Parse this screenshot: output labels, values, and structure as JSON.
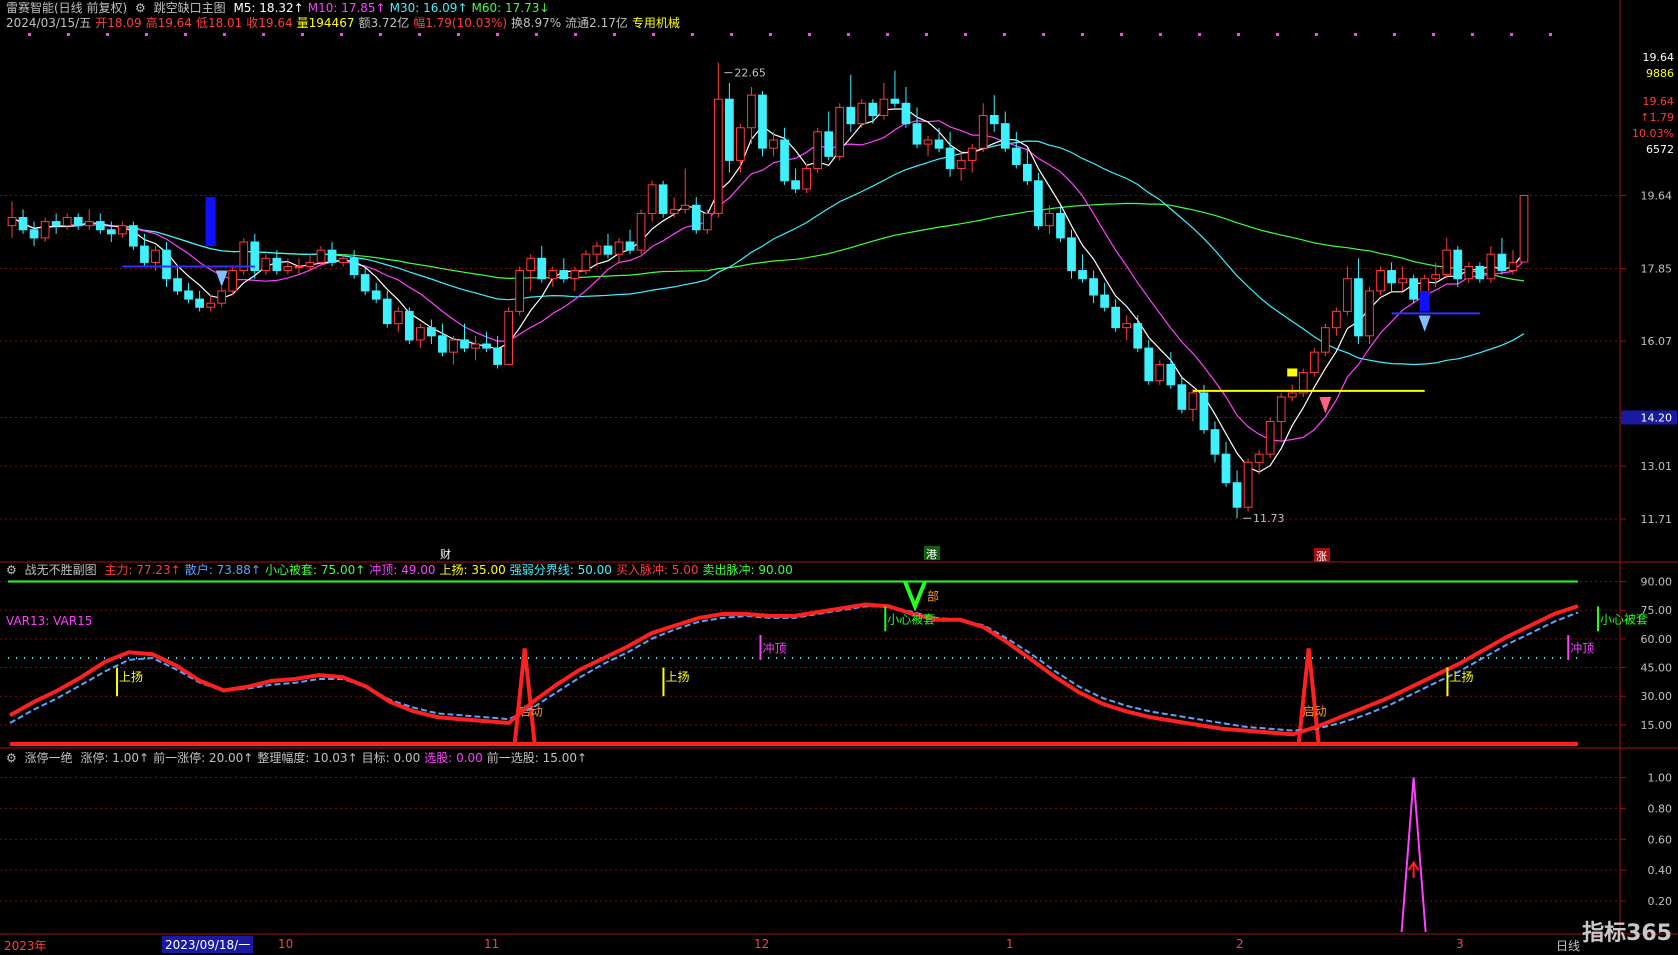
{
  "header": {
    "title": "雷赛智能(日线 前复权)",
    "indicator": "跳空缺口主图",
    "ma": [
      {
        "label": "M5:",
        "value": "18.32↑",
        "color": "#ffffff"
      },
      {
        "label": "M10:",
        "value": "17.85↑",
        "color": "#ff40ff"
      },
      {
        "label": "M30:",
        "value": "16.09↑",
        "color": "#3ff0ff"
      },
      {
        "label": "M60:",
        "value": "17.73↓",
        "color": "#40ff40"
      }
    ],
    "date": "2024/03/15/五",
    "open": "开18.09",
    "high": "高19.64",
    "low": "低18.01",
    "close": "收19.64",
    "vol": "量194467",
    "amount": "额3.72亿",
    "change": "幅1.79(10.03%)",
    "turnover": "换8.97%",
    "float": "流通2.17亿",
    "sector": "专用机械"
  },
  "right_info": [
    "19.64",
    "9886",
    "19.64",
    "↑1.79",
    "10.03%",
    "6572"
  ],
  "main_axis": [
    "19.64",
    "17.85",
    "16.07",
    "14.20",
    "13.01",
    "11.71"
  ],
  "annotations": {
    "high": "22.65",
    "low": "11.73",
    "cai": "财",
    "gang": "港",
    "zhang": "涨"
  },
  "sub1": {
    "title": "战无不胜副图",
    "legend": [
      {
        "label": "主力:",
        "value": "77.23↑",
        "color": "#ff3c3c"
      },
      {
        "label": "散户:",
        "value": "73.88↑",
        "color": "#60a0ff"
      },
      {
        "label": "小心被套:",
        "value": "75.00↑",
        "color": "#40ff40"
      },
      {
        "label": "冲顶:",
        "value": "49.00",
        "color": "#ff40ff"
      },
      {
        "label": "上扬:",
        "value": "35.00",
        "color": "#ffff00"
      },
      {
        "label": "强弱分界线:",
        "value": "50.00",
        "color": "#3ff0ff"
      },
      {
        "label": "买入脉冲:",
        "value": "5.00",
        "color": "#ff3c3c"
      },
      {
        "label": "卖出脉冲:",
        "value": "90.00",
        "color": "#40ff40"
      }
    ],
    "var_label": "VAR13: VAR15",
    "axis": [
      "90.00",
      "75.00",
      "60.00",
      "45.00",
      "30.00",
      "15.00"
    ],
    "tags": {
      "up": "上扬",
      "top": "冲顶",
      "trap": "小心被套",
      "start": "启动",
      "bu": "部"
    }
  },
  "sub2": {
    "title": "涨停一绝",
    "legend": [
      {
        "label": "涨停:",
        "value": "1.00↑",
        "color": "#c0c0c0"
      },
      {
        "label": "前一涨停:",
        "value": "20.00↑",
        "color": "#c0c0c0"
      },
      {
        "label": "整理幅度:",
        "value": "10.03↑",
        "color": "#c0c0c0"
      },
      {
        "label": "目标:",
        "value": "0.00",
        "color": "#c0c0c0"
      },
      {
        "label": "选股:",
        "value": "0.00",
        "color": "#ff40ff"
      },
      {
        "label": "前一选股:",
        "value": "15.00↑",
        "color": "#c0c0c0"
      }
    ],
    "axis": [
      "1.00",
      "0.80",
      "0.60",
      "0.40",
      "0.20"
    ]
  },
  "dates": {
    "year": "2023年",
    "cursor": "2023/09/18/一",
    "m10": "10",
    "m11": "11",
    "m12": "12",
    "m1": "1",
    "m2": "2",
    "m3": "3",
    "period": "日线"
  },
  "logo": "指标365",
  "chart_data": [
    {
      "type": "candlestick",
      "title": "跳空缺口主图",
      "ylim": [
        11.0,
        23.5
      ],
      "y_ticks": [
        19.64,
        17.85,
        16.07,
        14.2,
        13.01,
        11.71
      ],
      "ohlc": [
        [
          18.9,
          19.5,
          18.6,
          19.1
        ],
        [
          19.1,
          19.3,
          18.7,
          18.8
        ],
        [
          18.8,
          19.0,
          18.4,
          18.6
        ],
        [
          18.6,
          19.1,
          18.5,
          19.0
        ],
        [
          19.0,
          19.2,
          18.7,
          18.9
        ],
        [
          18.9,
          19.2,
          18.8,
          19.1
        ],
        [
          19.1,
          19.2,
          18.8,
          18.9
        ],
        [
          18.9,
          19.3,
          18.8,
          19.0
        ],
        [
          19.0,
          19.2,
          18.7,
          18.8
        ],
        [
          18.8,
          19.0,
          18.5,
          18.7
        ],
        [
          18.7,
          19.0,
          18.6,
          18.9
        ],
        [
          18.9,
          19.0,
          18.3,
          18.4
        ],
        [
          18.4,
          18.7,
          17.9,
          18.0
        ],
        [
          18.0,
          18.4,
          17.8,
          18.3
        ],
        [
          18.3,
          18.5,
          17.4,
          17.6
        ],
        [
          17.6,
          17.9,
          17.2,
          17.3
        ],
        [
          17.3,
          17.5,
          17.0,
          17.1
        ],
        [
          17.1,
          17.3,
          16.8,
          16.9
        ],
        [
          16.9,
          17.2,
          16.8,
          17.0
        ],
        [
          17.0,
          17.4,
          16.9,
          17.3
        ],
        [
          17.3,
          17.9,
          17.2,
          17.8
        ],
        [
          17.8,
          18.6,
          17.7,
          18.5
        ],
        [
          18.5,
          18.7,
          17.6,
          17.8
        ],
        [
          17.8,
          18.2,
          17.7,
          18.1
        ],
        [
          18.1,
          18.3,
          17.7,
          17.8
        ],
        [
          17.8,
          18.1,
          17.7,
          17.9
        ],
        [
          17.9,
          18.1,
          17.7,
          17.9
        ],
        [
          17.9,
          18.2,
          17.8,
          18.0
        ],
        [
          18.0,
          18.4,
          17.9,
          18.3
        ],
        [
          18.3,
          18.5,
          17.9,
          18.0
        ],
        [
          18.0,
          18.2,
          17.9,
          18.1
        ],
        [
          18.1,
          18.3,
          17.6,
          17.7
        ],
        [
          17.7,
          17.9,
          17.2,
          17.3
        ],
        [
          17.3,
          17.5,
          17.0,
          17.1
        ],
        [
          17.1,
          17.3,
          16.4,
          16.5
        ],
        [
          16.5,
          16.9,
          16.3,
          16.8
        ],
        [
          16.8,
          16.9,
          16.0,
          16.1
        ],
        [
          16.1,
          16.5,
          15.9,
          16.4
        ],
        [
          16.4,
          16.6,
          16.0,
          16.2
        ],
        [
          16.2,
          16.5,
          15.7,
          15.8
        ],
        [
          15.8,
          16.2,
          15.5,
          16.1
        ],
        [
          16.1,
          16.5,
          15.8,
          15.9
        ],
        [
          15.9,
          16.2,
          15.6,
          16.0
        ],
        [
          16.0,
          16.3,
          15.8,
          15.9
        ],
        [
          15.9,
          16.2,
          15.4,
          15.5
        ],
        [
          15.5,
          16.9,
          15.5,
          16.8
        ],
        [
          16.8,
          17.9,
          16.7,
          17.8
        ],
        [
          17.8,
          18.2,
          17.3,
          18.1
        ],
        [
          18.1,
          18.4,
          17.5,
          17.6
        ],
        [
          17.6,
          17.9,
          17.4,
          17.8
        ],
        [
          17.8,
          18.1,
          17.5,
          17.6
        ],
        [
          17.6,
          17.9,
          17.3,
          17.8
        ],
        [
          17.8,
          18.3,
          17.7,
          18.2
        ],
        [
          18.2,
          18.5,
          17.9,
          18.4
        ],
        [
          18.4,
          18.7,
          18.1,
          18.2
        ],
        [
          18.2,
          18.6,
          18.0,
          18.5
        ],
        [
          18.5,
          18.8,
          18.2,
          18.3
        ],
        [
          18.3,
          19.3,
          18.2,
          19.2
        ],
        [
          19.2,
          20.0,
          19.0,
          19.9
        ],
        [
          19.9,
          20.0,
          19.1,
          19.2
        ],
        [
          19.2,
          19.6,
          19.1,
          19.3
        ],
        [
          19.3,
          20.3,
          19.2,
          19.4
        ],
        [
          19.4,
          19.6,
          18.7,
          18.8
        ],
        [
          18.8,
          19.3,
          18.7,
          19.2
        ],
        [
          19.2,
          22.9,
          19.1,
          22.0
        ],
        [
          22.0,
          22.4,
          20.2,
          20.5
        ],
        [
          20.5,
          21.4,
          20.2,
          21.3
        ],
        [
          21.3,
          22.3,
          20.9,
          22.1
        ],
        [
          22.1,
          22.2,
          20.6,
          20.8
        ],
        [
          20.8,
          21.2,
          20.6,
          21.0
        ],
        [
          21.0,
          21.3,
          19.9,
          20.0
        ],
        [
          20.0,
          20.3,
          19.7,
          19.8
        ],
        [
          19.8,
          20.4,
          19.7,
          20.3
        ],
        [
          20.3,
          21.3,
          20.2,
          21.2
        ],
        [
          21.2,
          21.7,
          20.5,
          20.6
        ],
        [
          20.6,
          21.9,
          20.5,
          21.8
        ],
        [
          21.8,
          22.6,
          21.2,
          21.4
        ],
        [
          21.4,
          22.0,
          21.3,
          21.9
        ],
        [
          21.9,
          22.0,
          21.4,
          21.6
        ],
        [
          21.6,
          22.4,
          21.5,
          22.0
        ],
        [
          22.0,
          22.7,
          21.8,
          21.9
        ],
        [
          21.9,
          22.3,
          21.3,
          21.4
        ],
        [
          21.4,
          21.8,
          20.8,
          20.9
        ],
        [
          20.9,
          21.1,
          20.6,
          21.0
        ],
        [
          21.0,
          21.3,
          20.7,
          20.8
        ],
        [
          20.8,
          21.2,
          20.1,
          20.3
        ],
        [
          20.3,
          20.7,
          20.0,
          20.5
        ],
        [
          20.5,
          20.9,
          20.2,
          20.8
        ],
        [
          20.8,
          21.9,
          20.7,
          21.6
        ],
        [
          21.6,
          22.1,
          21.2,
          21.4
        ],
        [
          21.4,
          21.7,
          20.7,
          20.8
        ],
        [
          20.8,
          21.2,
          20.3,
          20.4
        ],
        [
          20.4,
          20.8,
          19.9,
          20.0
        ],
        [
          20.0,
          20.2,
          18.8,
          18.9
        ],
        [
          18.9,
          19.4,
          18.7,
          19.2
        ],
        [
          19.2,
          19.4,
          18.5,
          18.6
        ],
        [
          18.6,
          18.8,
          17.6,
          17.8
        ],
        [
          17.8,
          18.2,
          17.5,
          17.6
        ],
        [
          17.6,
          17.8,
          17.0,
          17.2
        ],
        [
          17.2,
          17.5,
          16.8,
          16.9
        ],
        [
          16.9,
          17.1,
          16.3,
          16.4
        ],
        [
          16.4,
          16.7,
          16.1,
          16.5
        ],
        [
          16.5,
          16.7,
          15.8,
          15.9
        ],
        [
          15.9,
          16.1,
          15.0,
          15.1
        ],
        [
          15.1,
          15.6,
          15.0,
          15.5
        ],
        [
          15.5,
          15.8,
          14.9,
          15.0
        ],
        [
          15.0,
          15.2,
          14.3,
          14.4
        ],
        [
          14.4,
          14.9,
          14.1,
          14.8
        ],
        [
          14.8,
          15.0,
          13.8,
          13.9
        ],
        [
          13.9,
          14.1,
          13.1,
          13.3
        ],
        [
          13.3,
          13.6,
          12.5,
          12.6
        ],
        [
          12.6,
          12.9,
          11.73,
          12.0
        ],
        [
          12.0,
          13.2,
          11.9,
          13.1
        ],
        [
          13.1,
          13.4,
          12.8,
          13.3
        ],
        [
          13.3,
          14.2,
          13.2,
          14.1
        ],
        [
          14.1,
          14.8,
          13.6,
          14.7
        ],
        [
          14.7,
          15.0,
          14.6,
          14.8
        ],
        [
          14.8,
          15.4,
          14.7,
          15.3
        ],
        [
          15.3,
          15.9,
          15.2,
          15.8
        ],
        [
          15.8,
          16.5,
          15.7,
          16.4
        ],
        [
          16.4,
          16.9,
          16.2,
          16.8
        ],
        [
          16.8,
          17.9,
          16.7,
          17.6
        ],
        [
          17.6,
          18.1,
          16.0,
          16.2
        ],
        [
          16.2,
          17.4,
          16.0,
          17.3
        ],
        [
          17.3,
          17.9,
          17.2,
          17.8
        ],
        [
          17.8,
          18.0,
          17.3,
          17.5
        ],
        [
          17.5,
          17.9,
          17.3,
          17.6
        ],
        [
          17.6,
          17.7,
          17.0,
          17.1
        ],
        [
          17.1,
          17.7,
          17.0,
          17.6
        ],
        [
          17.6,
          18.0,
          17.4,
          17.7
        ],
        [
          17.7,
          18.6,
          17.6,
          18.3
        ],
        [
          18.3,
          18.4,
          17.4,
          17.6
        ],
        [
          17.6,
          18.0,
          17.5,
          17.9
        ],
        [
          17.9,
          18.0,
          17.5,
          17.6
        ],
        [
          17.6,
          18.4,
          17.5,
          18.2
        ],
        [
          18.2,
          18.6,
          17.7,
          17.8
        ],
        [
          17.8,
          18.3,
          17.7,
          18.0
        ],
        [
          18.01,
          19.64,
          18.01,
          19.64
        ]
      ]
    },
    {
      "type": "line",
      "title": "战无不胜副图",
      "ylim": [
        5,
        95
      ],
      "y_ticks": [
        90,
        75,
        60,
        45,
        30,
        15
      ],
      "series": [
        {
          "name": "主力",
          "color": "#ff2020",
          "values": [
            20,
            27,
            33,
            40,
            48,
            53,
            52,
            46,
            38,
            33,
            35,
            38,
            39,
            41,
            40,
            35,
            27,
            22,
            19,
            18,
            17,
            16,
            27,
            36,
            44,
            50,
            56,
            63,
            67,
            71,
            73,
            73,
            72,
            72,
            74,
            76,
            78,
            77,
            73,
            70,
            70,
            66,
            58,
            49,
            40,
            32,
            26,
            22,
            19,
            17,
            15,
            13,
            12,
            11,
            10,
            14,
            19,
            24,
            29,
            35,
            41,
            47,
            54,
            61,
            67,
            73,
            77.23
          ]
        },
        {
          "name": "散户",
          "color": "#60a0ff",
          "values": [
            16,
            23,
            29,
            36,
            43,
            49,
            50,
            44,
            37,
            33,
            34,
            36,
            37,
            39,
            39,
            35,
            28,
            24,
            21,
            20,
            19,
            18,
            24,
            32,
            40,
            47,
            53,
            60,
            65,
            69,
            71,
            72,
            71,
            71,
            73,
            75,
            77,
            77,
            74,
            71,
            70,
            67,
            60,
            52,
            43,
            35,
            29,
            25,
            22,
            20,
            18,
            16,
            14,
            13,
            12,
            13,
            16,
            20,
            25,
            31,
            37,
            43,
            50,
            57,
            63,
            69,
            73.88
          ]
        }
      ],
      "spikes": [
        22,
        55
      ]
    },
    {
      "type": "line",
      "title": "涨停一绝",
      "ylim": [
        0,
        1.1
      ],
      "y_ticks": [
        1.0,
        0.8,
        0.6,
        0.4,
        0.2
      ],
      "series": [
        {
          "name": "选股",
          "color": "#ff40ff",
          "spike_index": 127,
          "value": 1.0
        }
      ]
    }
  ]
}
